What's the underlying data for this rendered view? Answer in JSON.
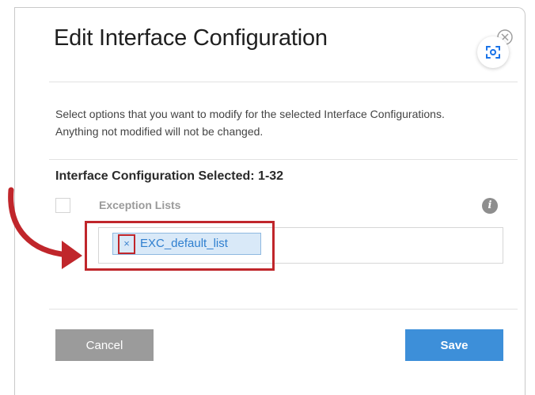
{
  "dialog": {
    "title": "Edit Interface Configuration",
    "description": "Select options that you want to modify for the selected Interface Configurations. Anything not modified will not be changed.",
    "selected_label": "Interface Configuration Selected: 1-32"
  },
  "exception_lists": {
    "label": "Exception Lists",
    "checked": false,
    "tags": [
      {
        "remove_glyph": "×",
        "value": "EXC_default_list"
      }
    ]
  },
  "buttons": {
    "cancel_label": "Cancel",
    "save_label": "Save"
  },
  "icons": {
    "close": "close-icon",
    "lens": "lens-scan-icon",
    "info": "info-icon",
    "info_glyph": "i",
    "arrow": "arrow-icon"
  },
  "colors": {
    "primary": "#3d8fd9",
    "secondary_button": "#9b9b9b",
    "annotation": "#c0262b",
    "tag_background": "#d9e9f8",
    "tag_text": "#2f7fcf"
  }
}
